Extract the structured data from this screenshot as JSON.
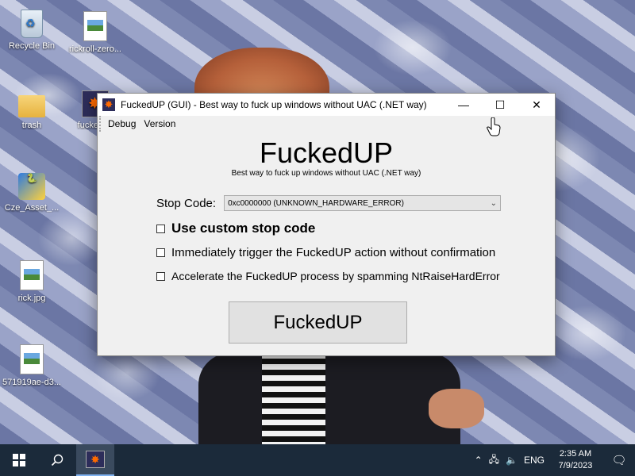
{
  "desktop": {
    "icons": [
      {
        "label": "Recycle Bin",
        "icon": "recycle-bin-icon"
      },
      {
        "label": "rickroll-zero...",
        "icon": "image-file-icon"
      },
      {
        "label": "trash",
        "icon": "folder-icon"
      },
      {
        "label": "fuckedup",
        "icon": "fuckedup-app-icon"
      },
      {
        "label": "Cze_Asset_...",
        "icon": "python-app-icon"
      },
      {
        "label": "rick.jpg",
        "icon": "image-file-icon"
      },
      {
        "label": "571919ae-d3...",
        "icon": "image-file-icon"
      }
    ]
  },
  "window": {
    "title": "FuckedUP (GUI) - Best way to fuck up windows without UAC (.NET way)",
    "controls": {
      "minimize": "—",
      "maximize": "☐",
      "close": "✕"
    },
    "menu": [
      "Debug",
      "Version"
    ],
    "heading": "FuckedUP",
    "subheading": "Best way to fuck up windows without UAC (.NET way)",
    "stop_code_label": "Stop Code:",
    "stop_code_value": "0xc0000000 (UNKNOWN_HARDWARE_ERROR)",
    "options": [
      "Use custom stop code",
      "Immediately trigger the FuckedUP action without confirmation",
      "Accelerate the FuckedUP process by spamming NtRaiseHardError"
    ],
    "action_button": "FuckedUP"
  },
  "taskbar": {
    "language": "ENG",
    "time": "2:35 AM",
    "date": "7/9/2023"
  }
}
